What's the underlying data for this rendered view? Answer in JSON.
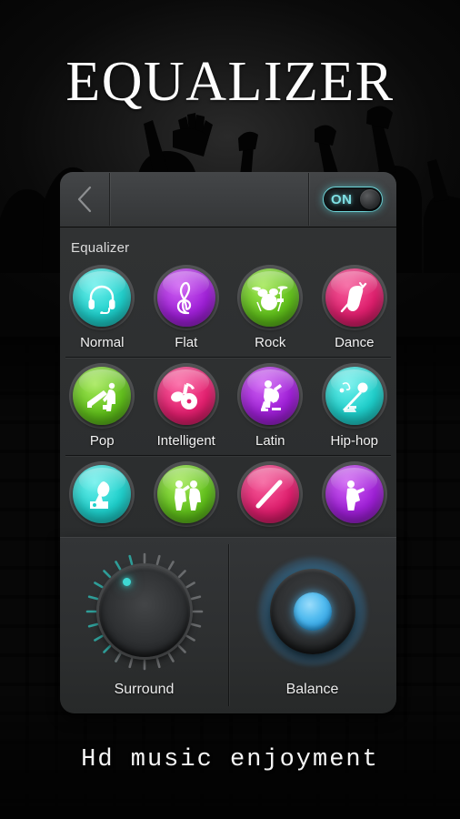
{
  "app": {
    "title": "EQUALIZER",
    "footer_tagline": "Hd music enjoyment"
  },
  "topbar": {
    "back_icon": "chevron-left-icon",
    "power_toggle": {
      "label": "ON",
      "state": "on",
      "accent_color": "#6fd6da"
    }
  },
  "equalizer": {
    "section_label": "Equalizer",
    "presets": [
      {
        "label": "Normal",
        "icon": "headset-icon",
        "color": "#1fd0cc"
      },
      {
        "label": "Flat",
        "icon": "treble-clef-icon",
        "color": "#a020d8"
      },
      {
        "label": "Rock",
        "icon": "drum-kit-icon",
        "color": "#62c11c"
      },
      {
        "label": "Dance",
        "icon": "violin-icon",
        "color": "#e01f6e"
      },
      {
        "label": "Pop",
        "icon": "piano-icon",
        "color": "#62c11c"
      },
      {
        "label": "Intelligent",
        "icon": "music-notes-icon",
        "color": "#e52070"
      },
      {
        "label": "Latin",
        "icon": "guitarist-icon",
        "color": "#a020d8"
      },
      {
        "label": "Hip-hop",
        "icon": "microphone-icon",
        "color": "#1fd0cc"
      },
      {
        "label": "",
        "icon": "gramophone-icon",
        "color": "#1fd0cc"
      },
      {
        "label": "",
        "icon": "duo-singers-icon",
        "color": "#62c11c"
      },
      {
        "label": "",
        "icon": "drumstick-icon",
        "color": "#e01f6e"
      },
      {
        "label": "",
        "icon": "dj-figure-icon",
        "color": "#a020d8"
      }
    ]
  },
  "controls": {
    "surround": {
      "label": "Surround",
      "indicator_color": "#3fd9d4",
      "tick_color": "#2f9e99"
    },
    "balance": {
      "label": "Balance",
      "glow_color": "#46afeb",
      "center_color": "#3aaee8"
    }
  }
}
